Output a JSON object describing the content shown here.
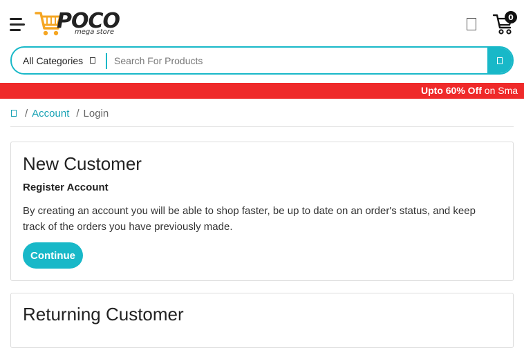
{
  "header": {
    "logo": {
      "name": "POCO",
      "tagline": "mega store"
    },
    "cart": {
      "count": "0"
    }
  },
  "search": {
    "category_label": "All Categories",
    "placeholder": "Search For Products",
    "value": ""
  },
  "promo": {
    "highlight": "Upto 60% Off",
    "text": " on Sma"
  },
  "breadcrumb": {
    "separator": "/",
    "items": [
      {
        "label": "Account"
      },
      {
        "label": "Login"
      }
    ]
  },
  "new_customer": {
    "title": "New Customer",
    "subtitle": "Register Account",
    "description": "By creating an account you will be able to shop faster, be up to date on an order's status, and keep track of the orders you have previously made.",
    "button_label": "Continue"
  },
  "returning_customer": {
    "title": "Returning Customer"
  },
  "colors": {
    "accent": "#18b8c8",
    "promo": "#ef2a2a",
    "logo_cart": "#f5a623"
  },
  "icons": [
    "menu-icon",
    "poco-cart-logo-icon",
    "user-icon",
    "cart-icon",
    "chevron-down-icon",
    "search-icon",
    "home-icon"
  ]
}
